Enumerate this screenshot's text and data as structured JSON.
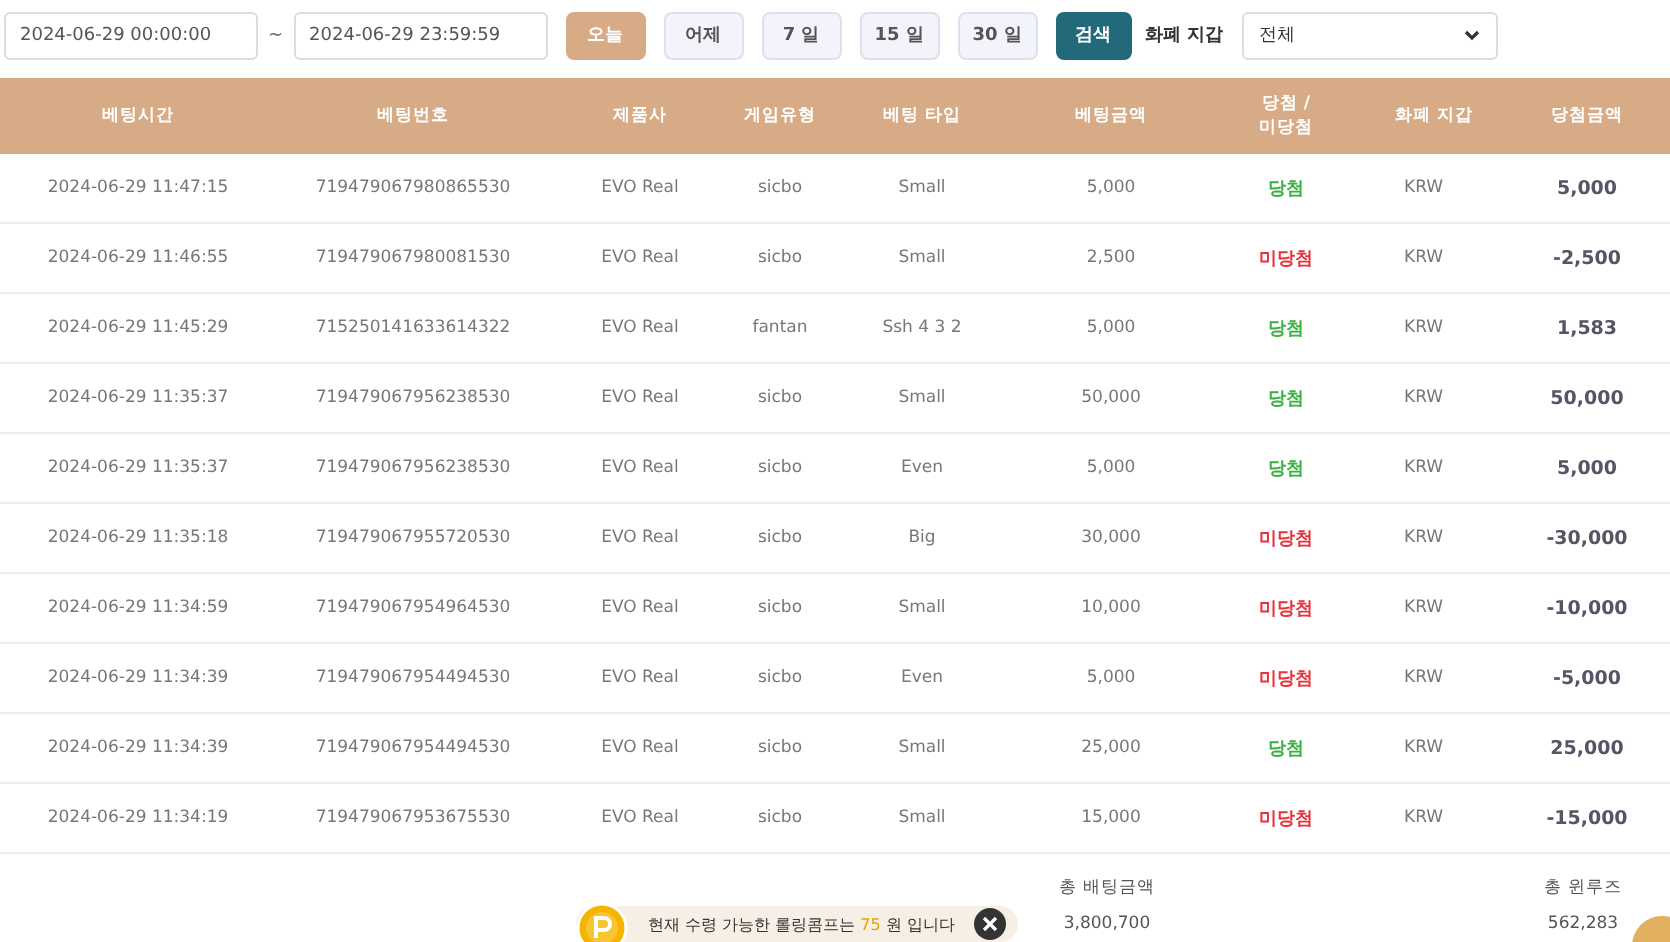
{
  "filters": {
    "date_from": "2024-06-29 00:00:00",
    "separator": "~",
    "date_to": "2024-06-29 23:59:59",
    "range_buttons": [
      {
        "label": "오늘",
        "selected": true
      },
      {
        "label": "어제",
        "selected": false
      },
      {
        "label": "7 일",
        "selected": false
      },
      {
        "label": "15 일",
        "selected": false
      },
      {
        "label": "30 일",
        "selected": false
      }
    ],
    "search_button": "검색",
    "currency_label": "화폐 지갑",
    "currency_select": "전체"
  },
  "table": {
    "columns": [
      "베팅시간",
      "베팅번호",
      "제품사",
      "게임유형",
      "베팅 타입",
      "베팅금액",
      "당첨 / 미당첨",
      "화폐 지갑",
      "당첨금액"
    ],
    "rows": [
      {
        "time": "2024-06-29 11:47:15",
        "bet_no": "719479067980865530",
        "provider": "EVO Real",
        "game": "sicbo",
        "bet_type": "Small",
        "amount": "5,000",
        "result": "당첨",
        "kind": "win",
        "currency": "KRW",
        "payout": "5,000"
      },
      {
        "time": "2024-06-29 11:46:55",
        "bet_no": "719479067980081530",
        "provider": "EVO Real",
        "game": "sicbo",
        "bet_type": "Small",
        "amount": "2,500",
        "result": "미당첨",
        "kind": "lose",
        "currency": "KRW",
        "payout": "-2,500"
      },
      {
        "time": "2024-06-29 11:45:29",
        "bet_no": "715250141633614322",
        "provider": "EVO Real",
        "game": "fantan",
        "bet_type": "Ssh 4 3 2",
        "amount": "5,000",
        "result": "당첨",
        "kind": "win",
        "currency": "KRW",
        "payout": "1,583"
      },
      {
        "time": "2024-06-29 11:35:37",
        "bet_no": "719479067956238530",
        "provider": "EVO Real",
        "game": "sicbo",
        "bet_type": "Small",
        "amount": "50,000",
        "result": "당첨",
        "kind": "win",
        "currency": "KRW",
        "payout": "50,000"
      },
      {
        "time": "2024-06-29 11:35:37",
        "bet_no": "719479067956238530",
        "provider": "EVO Real",
        "game": "sicbo",
        "bet_type": "Even",
        "amount": "5,000",
        "result": "당첨",
        "kind": "win",
        "currency": "KRW",
        "payout": "5,000"
      },
      {
        "time": "2024-06-29 11:35:18",
        "bet_no": "719479067955720530",
        "provider": "EVO Real",
        "game": "sicbo",
        "bet_type": "Big",
        "amount": "30,000",
        "result": "미당첨",
        "kind": "lose",
        "currency": "KRW",
        "payout": "-30,000"
      },
      {
        "time": "2024-06-29 11:34:59",
        "bet_no": "719479067954964530",
        "provider": "EVO Real",
        "game": "sicbo",
        "bet_type": "Small",
        "amount": "10,000",
        "result": "미당첨",
        "kind": "lose",
        "currency": "KRW",
        "payout": "-10,000"
      },
      {
        "time": "2024-06-29 11:34:39",
        "bet_no": "719479067954494530",
        "provider": "EVO Real",
        "game": "sicbo",
        "bet_type": "Even",
        "amount": "5,000",
        "result": "미당첨",
        "kind": "lose",
        "currency": "KRW",
        "payout": "-5,000"
      },
      {
        "time": "2024-06-29 11:34:39",
        "bet_no": "719479067954494530",
        "provider": "EVO Real",
        "game": "sicbo",
        "bet_type": "Small",
        "amount": "25,000",
        "result": "당첨",
        "kind": "win",
        "currency": "KRW",
        "payout": "25,000"
      },
      {
        "time": "2024-06-29 11:34:19",
        "bet_no": "719479067953675530",
        "provider": "EVO Real",
        "game": "sicbo",
        "bet_type": "Small",
        "amount": "15,000",
        "result": "미당첨",
        "kind": "lose",
        "currency": "KRW",
        "payout": "-15,000"
      }
    ]
  },
  "totals": {
    "bet_label": "총 배팅금액",
    "bet_value": "3,800,700",
    "winloss_label": "총 윈루즈",
    "winloss_value": "562,283"
  },
  "toast": {
    "text_before": "현재 수령 가능한 롤링콤프는",
    "amount": "75",
    "text_after": "원 입니다"
  }
}
